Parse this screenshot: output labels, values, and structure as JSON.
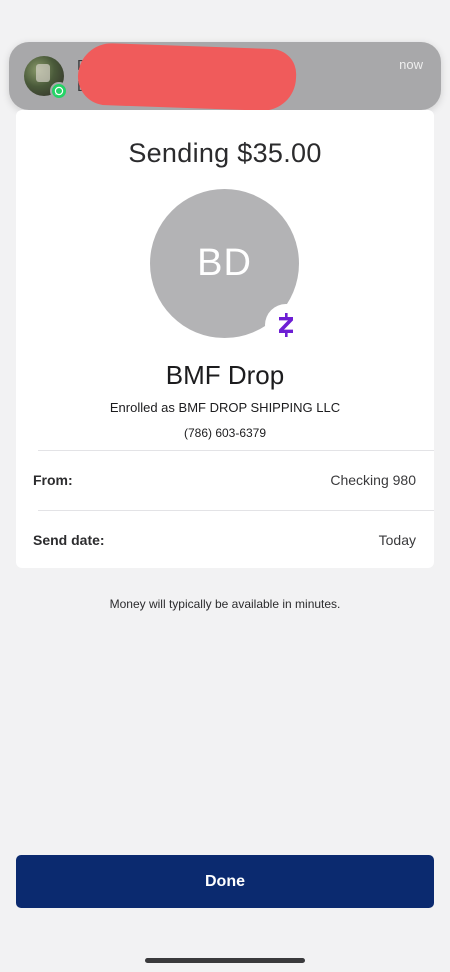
{
  "notification": {
    "line1": "D",
    "line2": "D",
    "time": "now",
    "app_icon": "whatsapp-icon"
  },
  "transfer": {
    "sending_text": "Sending $35.00"
  },
  "recipient": {
    "initials": "BD",
    "name": "BMF Drop",
    "enrolled_text": "Enrolled as BMF DROP SHIPPING LLC",
    "phone": "(786) 603-6379",
    "badge_icon": "zelle-icon"
  },
  "details": {
    "from_label": "From:",
    "from_value": "Checking 980",
    "send_date_label": "Send date:",
    "send_date_value": "Today"
  },
  "note": "Money will typically be available in minutes.",
  "actions": {
    "done_label": "Done"
  },
  "colors": {
    "primary": "#0b2a6f",
    "zelle": "#6d1ed4",
    "avatar_gray": "#b3b3b5",
    "whatsapp": "#25d366"
  }
}
